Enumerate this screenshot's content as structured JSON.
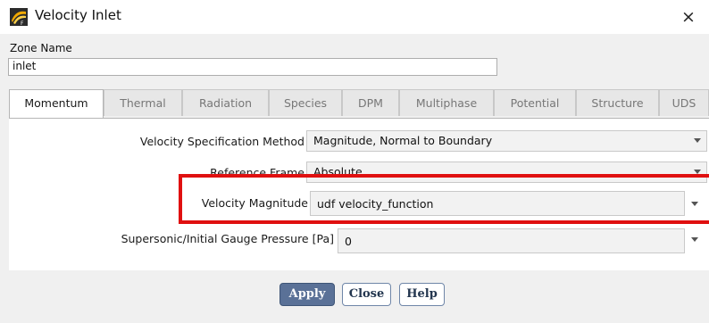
{
  "window": {
    "title": "Velocity Inlet",
    "close_glyph": "×"
  },
  "zone": {
    "label": "Zone Name",
    "value": "inlet"
  },
  "tabs": [
    {
      "label": "Momentum",
      "active": true
    },
    {
      "label": "Thermal"
    },
    {
      "label": "Radiation"
    },
    {
      "label": "Species"
    },
    {
      "label": "DPM"
    },
    {
      "label": "Multiphase"
    },
    {
      "label": "Potential"
    },
    {
      "label": "Structure"
    },
    {
      "label": "UDS"
    }
  ],
  "momentum": {
    "velocity_spec_method": {
      "label": "Velocity Specification Method",
      "value": "Magnitude, Normal to Boundary"
    },
    "reference_frame": {
      "label": "Reference Frame",
      "value": "Absolute"
    },
    "velocity_magnitude": {
      "label": "Velocity Magnitude",
      "value": "udf velocity_function"
    },
    "gauge_pressure": {
      "label": "Supersonic/Initial Gauge Pressure [Pa]",
      "value": "0"
    }
  },
  "buttons": {
    "apply": "Apply",
    "close": "Close",
    "help": "Help"
  },
  "colors": {
    "highlight": "#e01010",
    "primary_button": "#5a7197"
  }
}
